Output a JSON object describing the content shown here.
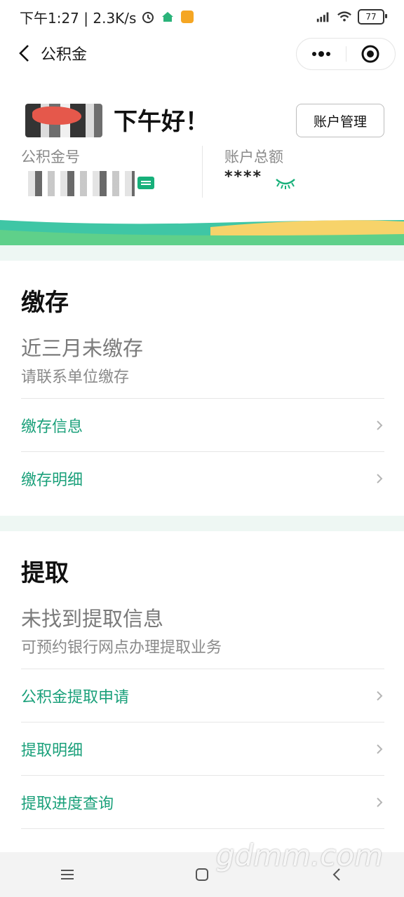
{
  "status_bar": {
    "time_speed": "下午1:27 | 2.3K/s",
    "battery": "77"
  },
  "title_bar": {
    "title": "公积金"
  },
  "header": {
    "greeting": "下午好！",
    "account_mgmt_label": "账户管理",
    "fund_no_label": "公积金号",
    "total_label": "账户总额",
    "total_value": "****"
  },
  "sections": [
    {
      "title": "缴存",
      "status": "近三月未缴存",
      "substatus": "请联系单位缴存",
      "items": [
        {
          "label": "缴存信息"
        },
        {
          "label": "缴存明细"
        }
      ]
    },
    {
      "title": "提取",
      "status": "未找到提取信息",
      "substatus": "可预约银行网点办理提取业务",
      "items": [
        {
          "label": "公积金提取申请"
        },
        {
          "label": "提取明细"
        },
        {
          "label": "提取进度查询"
        }
      ]
    }
  ],
  "watermark": "gdmm.com",
  "colors": {
    "accent": "#1aa07a",
    "content_bg": "#eef7f3"
  }
}
